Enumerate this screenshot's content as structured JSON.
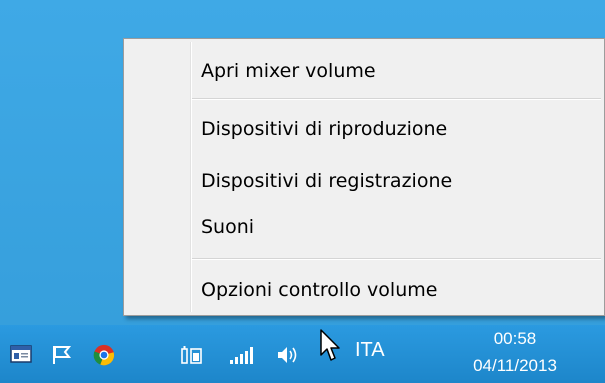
{
  "context_menu": {
    "items": [
      {
        "label": "Apri mixer volume"
      },
      {
        "label": "Dispositivi di riproduzione"
      },
      {
        "label": "Dispositivi di registrazione"
      },
      {
        "label": "Suoni"
      },
      {
        "label": "Opzioni controllo volume"
      }
    ]
  },
  "taskbar": {
    "tray_icons": [
      "network-app-icon",
      "action-center-flag-icon",
      "chrome-icon",
      "battery-icon",
      "signal-strength-icon",
      "speaker-volume-icon"
    ],
    "language": "ITA",
    "clock": {
      "time": "00:58",
      "date": "04/11/2013"
    }
  },
  "colors": {
    "desktop": "#3aa6e3",
    "taskbar": "#1e8bd1",
    "menu_bg": "#f0f0f0"
  }
}
